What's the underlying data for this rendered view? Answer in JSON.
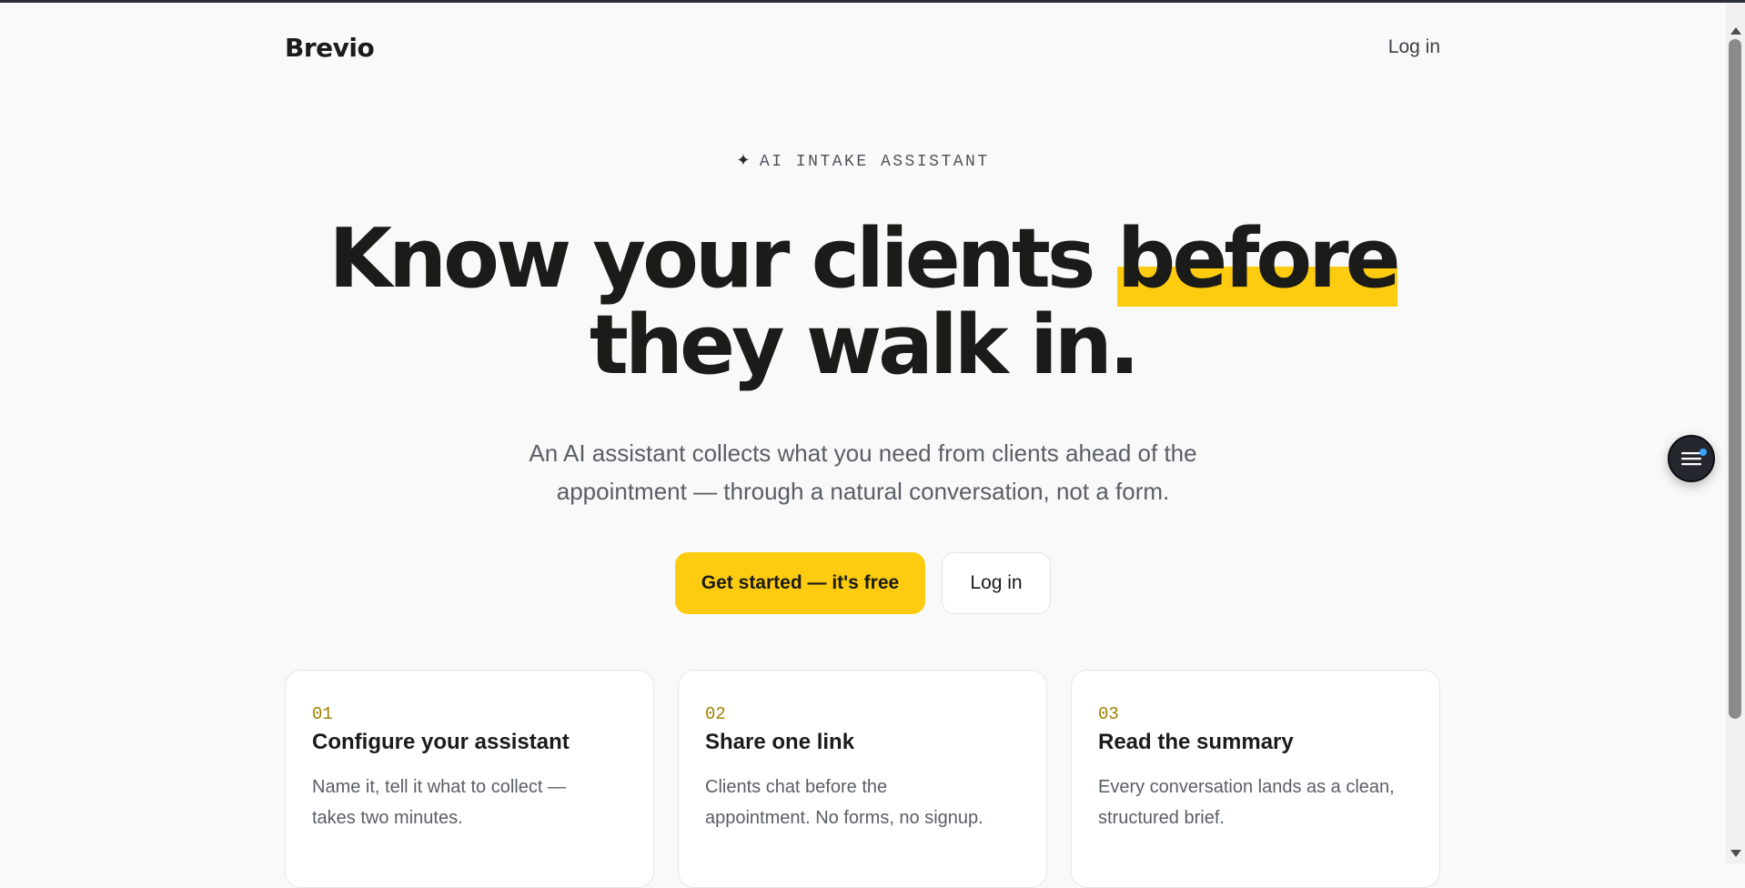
{
  "header": {
    "brand": "Brevio",
    "login_label": "Log in"
  },
  "hero": {
    "eyebrow_icon": "sparkle-icon",
    "eyebrow_glyph": "✦",
    "eyebrow": "AI INTAKE ASSISTANT",
    "headline_part1": "Know your clients ",
    "headline_highlight": "before",
    "headline_part2": "they walk in.",
    "subtitle_line1": "An AI assistant collects what you need from clients ahead of the",
    "subtitle_line2": "appointment — through a natural conversation, not a form.",
    "primary_cta": "Get started — it's free",
    "secondary_cta": "Log in"
  },
  "steps": [
    {
      "number": "01",
      "title": "Configure your assistant",
      "text_line1": "Name it, tell it what to collect —",
      "text_line2": "takes two minutes."
    },
    {
      "number": "02",
      "title": "Share one link",
      "text_line1": "Clients chat before the",
      "text_line2": "appointment. No forms, no signup."
    },
    {
      "number": "03",
      "title": "Read the summary",
      "text_line1": "Every conversation lands as a clean,",
      "text_line2": "structured brief."
    }
  ],
  "widgets": {
    "chat_icon": "menu-lines-icon"
  },
  "colors": {
    "accent": "#fdcc10",
    "step_number": "#a07f00",
    "text_dark": "#1b1b19",
    "text_muted": "#5a5e66",
    "background": "#f9f9f9"
  }
}
